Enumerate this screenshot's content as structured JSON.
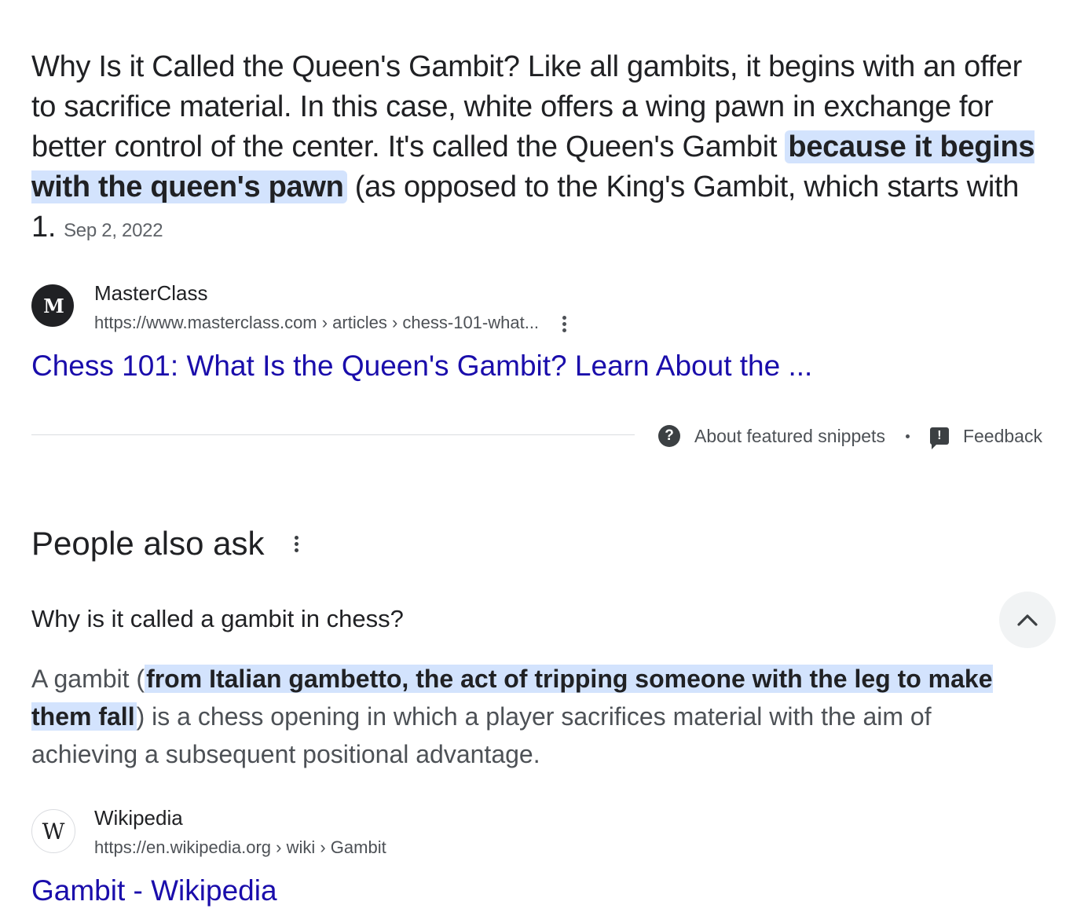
{
  "snippet": {
    "text_before": "Why Is it Called the Queen's Gambit? Like all gambits, it begins with an offer to sacrifice material. In this case, white offers a wing pawn in exchange for better control of the center. It's called the Queen's Gambit ",
    "highlight": "because it begins with the queen's pawn",
    "text_after": " (as opposed to the King's Gambit, which starts with 1.",
    "date": "Sep 2, 2022"
  },
  "source1": {
    "favicon_text": "M",
    "name": "MasterClass",
    "url": "https://www.masterclass.com › articles › chess-101-what...",
    "link_text": "Chess 101: What Is the Queen's Gambit? Learn About the ..."
  },
  "footer": {
    "about_label": "About featured snippets",
    "feedback_label": "Feedback",
    "about_icon": "help-circle-icon",
    "feedback_icon": "feedback-icon"
  },
  "paa": {
    "title": "People also ask",
    "question": "Why is it called a gambit in chess?",
    "answer_before": "A gambit (",
    "answer_highlight": "from Italian gambetto, the act of tripping someone with the leg to make them fall",
    "answer_after": ") is a chess opening in which a player sacrifices material with the aim of achieving a subsequent positional advantage."
  },
  "source2": {
    "favicon_text": "W",
    "name": "Wikipedia",
    "url": "https://en.wikipedia.org › wiki › Gambit",
    "link_text": "Gambit - Wikipedia"
  },
  "colors": {
    "link": "#1a0dab",
    "highlight": "#d3e3fd",
    "text": "#202124",
    "secondary": "#4d5156"
  }
}
